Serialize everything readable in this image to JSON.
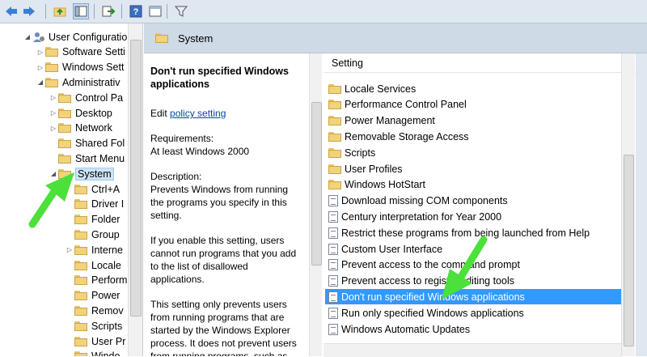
{
  "tree": {
    "items": [
      {
        "label": "User Configuratio",
        "level": 0,
        "expander": "◢",
        "type": "user"
      },
      {
        "label": "Software Setti",
        "level": 1,
        "expander": "▷",
        "type": "folder"
      },
      {
        "label": "Windows Sett",
        "level": 1,
        "expander": "▷",
        "type": "folder"
      },
      {
        "label": "Administrativ",
        "level": 1,
        "expander": "◢",
        "type": "folder"
      },
      {
        "label": "Control Pa",
        "level": 2,
        "expander": "▷",
        "type": "folder"
      },
      {
        "label": "Desktop",
        "level": 2,
        "expander": "▷",
        "type": "folder"
      },
      {
        "label": "Network",
        "level": 2,
        "expander": "▷",
        "type": "folder"
      },
      {
        "label": "Shared Fol",
        "level": 2,
        "expander": "",
        "type": "folder"
      },
      {
        "label": "Start Menu",
        "level": 2,
        "expander": "",
        "type": "folder"
      },
      {
        "label": "System",
        "level": 2,
        "expander": "◢",
        "type": "folder",
        "selected": true
      },
      {
        "label": "Ctrl+A",
        "level": 3,
        "expander": "",
        "type": "folder"
      },
      {
        "label": "Driver I",
        "level": 3,
        "expander": "",
        "type": "folder"
      },
      {
        "label": "Folder",
        "level": 3,
        "expander": "",
        "type": "folder"
      },
      {
        "label": "Group",
        "level": 3,
        "expander": "",
        "type": "folder"
      },
      {
        "label": "Interne",
        "level": 3,
        "expander": "▷",
        "type": "folder"
      },
      {
        "label": "Locale",
        "level": 3,
        "expander": "",
        "type": "folder"
      },
      {
        "label": "Perform",
        "level": 3,
        "expander": "",
        "type": "folder"
      },
      {
        "label": "Power",
        "level": 3,
        "expander": "",
        "type": "folder"
      },
      {
        "label": "Remov",
        "level": 3,
        "expander": "",
        "type": "folder"
      },
      {
        "label": "Scripts",
        "level": 3,
        "expander": "",
        "type": "folder"
      },
      {
        "label": "User Pr",
        "level": 3,
        "expander": "",
        "type": "folder"
      },
      {
        "label": "Windo",
        "level": 3,
        "expander": "",
        "type": "folder"
      }
    ]
  },
  "header": {
    "title": "System"
  },
  "description": {
    "title": "Don't run specified Windows applications",
    "edit_prefix": "Edit",
    "edit_link": "policy setting",
    "requirements_label": "Requirements:",
    "requirements_value": "At least Windows 2000",
    "description_label": "Description:",
    "description_text": "Prevents Windows from running the programs you specify in this setting.",
    "para2": "If you enable this setting, users cannot run programs that you add to the list of disallowed applications.",
    "para3": "This setting only prevents users from running programs that are started by the Windows Explorer process. It does not prevent users from running programs, such as"
  },
  "settings": {
    "column_header": "Setting",
    "rows": [
      {
        "label": "Locale Services",
        "type": "folder"
      },
      {
        "label": "Performance Control Panel",
        "type": "folder"
      },
      {
        "label": "Power Management",
        "type": "folder"
      },
      {
        "label": "Removable Storage Access",
        "type": "folder"
      },
      {
        "label": "Scripts",
        "type": "folder"
      },
      {
        "label": "User Profiles",
        "type": "folder"
      },
      {
        "label": "Windows HotStart",
        "type": "folder"
      },
      {
        "label": "Download missing COM components",
        "type": "policy"
      },
      {
        "label": "Century interpretation for Year 2000",
        "type": "policy"
      },
      {
        "label": "Restrict these programs from being launched from Help",
        "type": "policy"
      },
      {
        "label": "Custom User Interface",
        "type": "policy"
      },
      {
        "label": "Prevent access to the command prompt",
        "type": "policy"
      },
      {
        "label": "Prevent access to registry editing tools",
        "type": "policy"
      },
      {
        "label": "Don't run specified Windows applications",
        "type": "policy",
        "selected": true
      },
      {
        "label": "Run only specified Windows applications",
        "type": "policy"
      },
      {
        "label": "Windows Automatic Updates",
        "type": "policy"
      }
    ]
  },
  "colors": {
    "selection": "#3399ff",
    "header_bg": "#cfdae7",
    "annotation_arrow": "#4ce03a"
  }
}
